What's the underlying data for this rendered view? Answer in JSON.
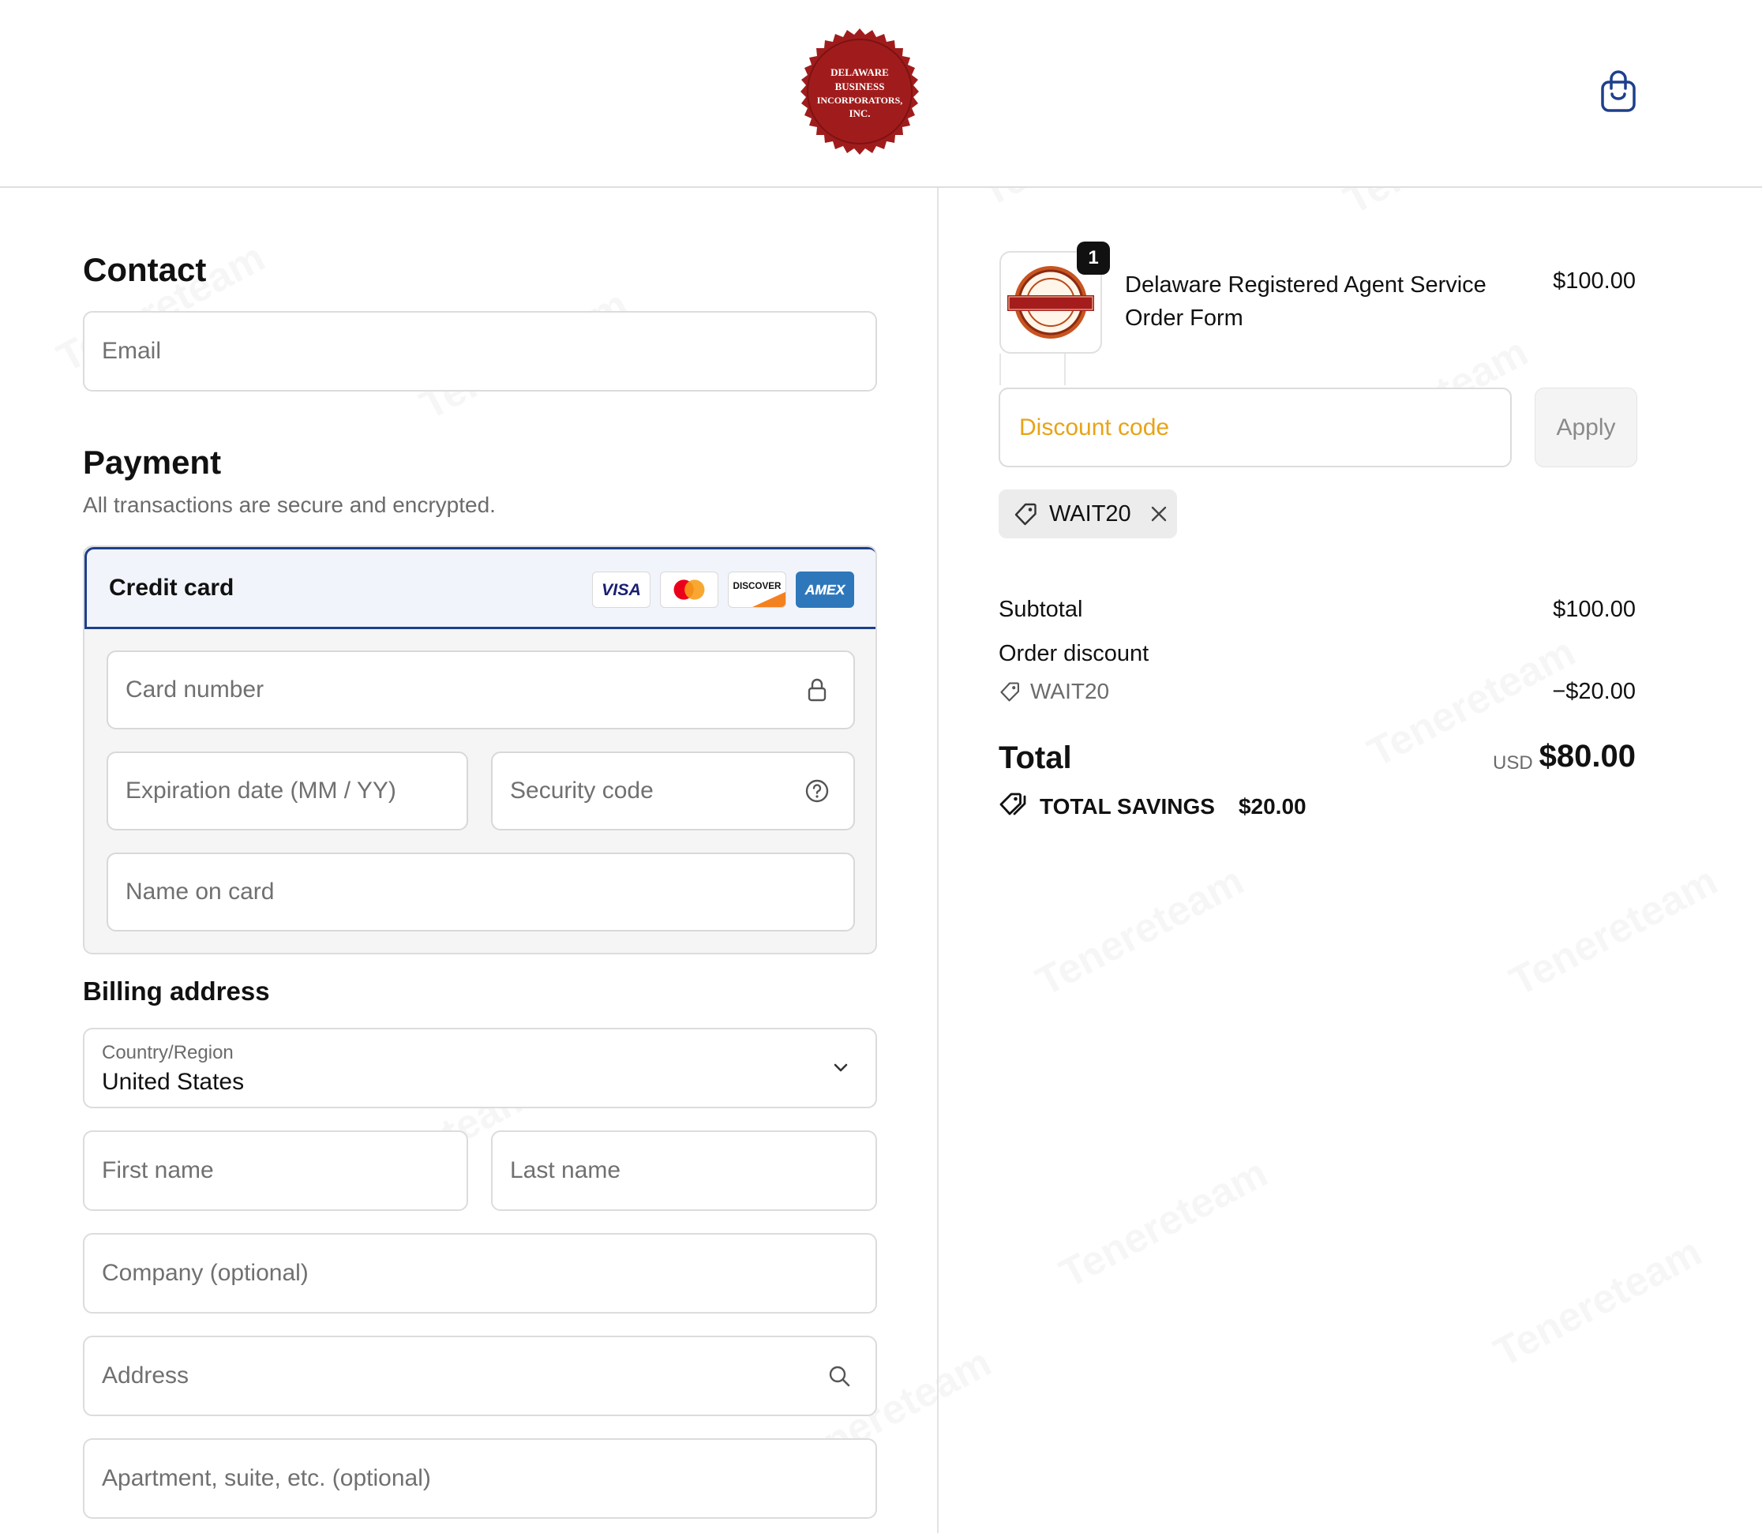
{
  "header": {
    "logo_lines": [
      "DELAWARE",
      "BUSINESS",
      "INCORPORATORS,",
      "INC."
    ]
  },
  "contact": {
    "heading": "Contact",
    "email_placeholder": "Email"
  },
  "payment": {
    "heading": "Payment",
    "subtext": "All transactions are secure and encrypted.",
    "method_label": "Credit card",
    "card_brands": [
      "VISA",
      "Mastercard",
      "DISCOVER",
      "AMEX"
    ],
    "card_number_placeholder": "Card number",
    "expiration_placeholder": "Expiration date (MM / YY)",
    "security_code_placeholder": "Security code",
    "name_on_card_placeholder": "Name on card"
  },
  "billing": {
    "heading": "Billing address",
    "country_label": "Country/Region",
    "country_value": "United States",
    "first_name_placeholder": "First name",
    "last_name_placeholder": "Last name",
    "company_placeholder": "Company (optional)",
    "address_placeholder": "Address",
    "apartment_placeholder": "Apartment, suite, etc. (optional)"
  },
  "order": {
    "quantity": "1",
    "product_name": "Delaware Registered Agent Service Order Form",
    "product_price": "$100.00",
    "discount_placeholder": "Discount code",
    "apply_label": "Apply",
    "applied_code": "WAIT20"
  },
  "summary": {
    "subtotal_label": "Subtotal",
    "subtotal_value": "$100.00",
    "order_discount_label": "Order discount",
    "discount_code": "WAIT20",
    "discount_value": "−$20.00",
    "total_label": "Total",
    "currency": "USD",
    "total_value": "$80.00",
    "savings_label": "TOTAL SAVINGS",
    "savings_value": "$20.00"
  },
  "colors": {
    "accent": "#1d3f8c",
    "seal": "#a01c1c",
    "discount_placeholder": "#e8a317"
  }
}
